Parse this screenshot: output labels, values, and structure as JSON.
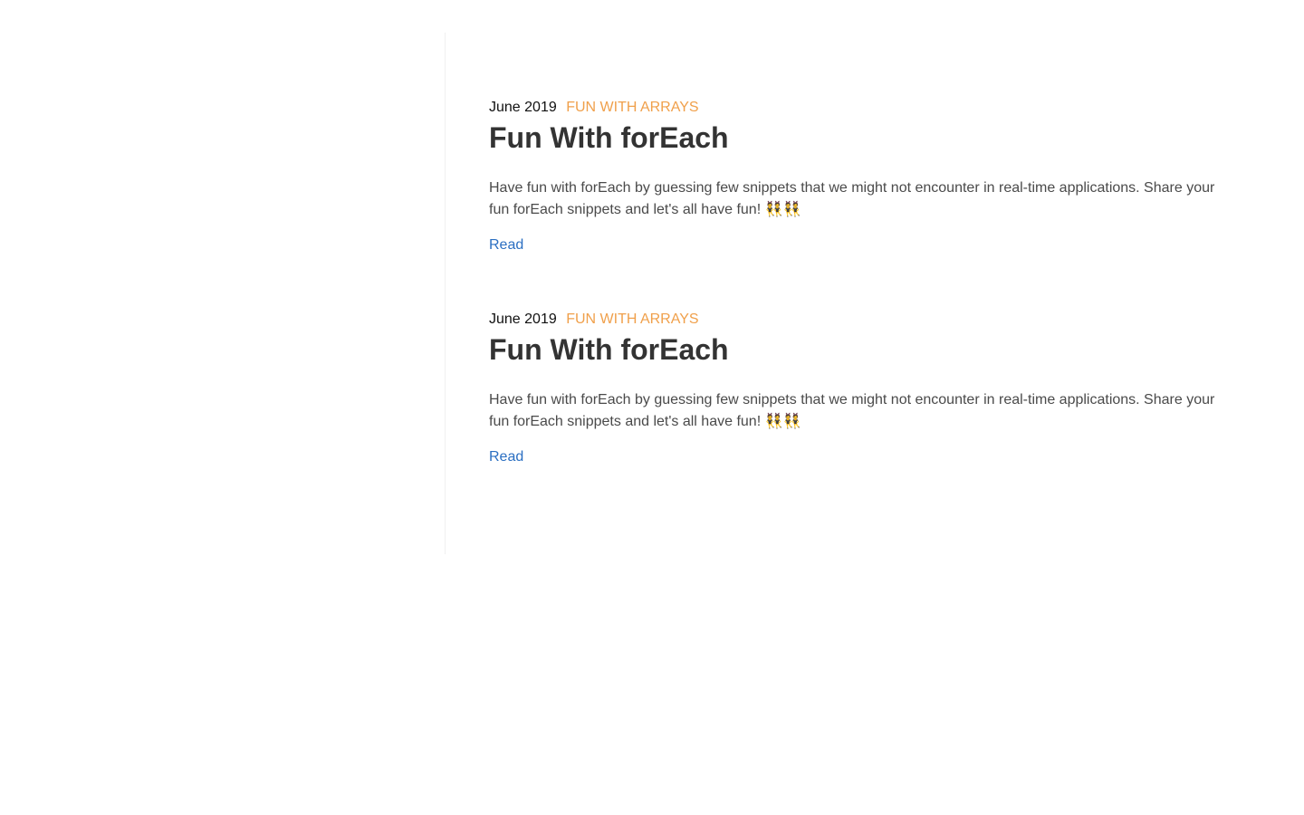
{
  "posts": [
    {
      "date": "June 2019",
      "category": "FUN WITH ARRAYS",
      "title": "Fun With forEach",
      "excerpt": "Have fun with forEach by guessing few snippets that we might not encounter in real-time applications. Share your fun forEach snippets and let's all have fun! 👯👯",
      "read_label": "Read"
    },
    {
      "date": "June 2019",
      "category": "FUN WITH ARRAYS",
      "title": "Fun With forEach",
      "excerpt": "Have fun with forEach by guessing few snippets that we might not encounter in real-time applications. Share your fun forEach snippets and let's all have fun! 👯👯",
      "read_label": "Read"
    }
  ],
  "colors": {
    "category": "#f0a04b",
    "link": "#2b6fc2",
    "title": "#333333",
    "divider": "#f0f0f0"
  }
}
